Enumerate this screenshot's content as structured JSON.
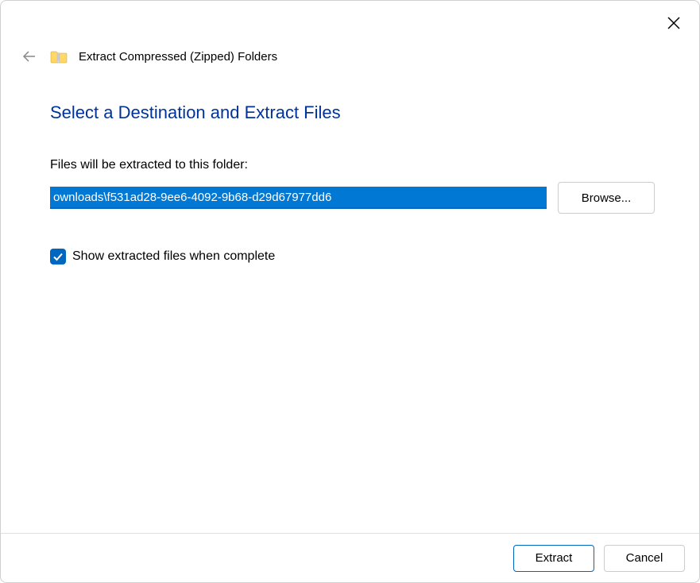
{
  "header": {
    "wizard_title": "Extract Compressed (Zipped) Folders"
  },
  "content": {
    "heading": "Select a Destination and Extract Files",
    "folder_label": "Files will be extracted to this folder:",
    "path_value": "ownloads\\f531ad28-9ee6-4092-9b68-d29d67977dd6",
    "browse_label": "Browse...",
    "checkbox_label": "Show extracted files when complete",
    "checkbox_checked": true
  },
  "footer": {
    "extract_label": "Extract",
    "cancel_label": "Cancel"
  }
}
